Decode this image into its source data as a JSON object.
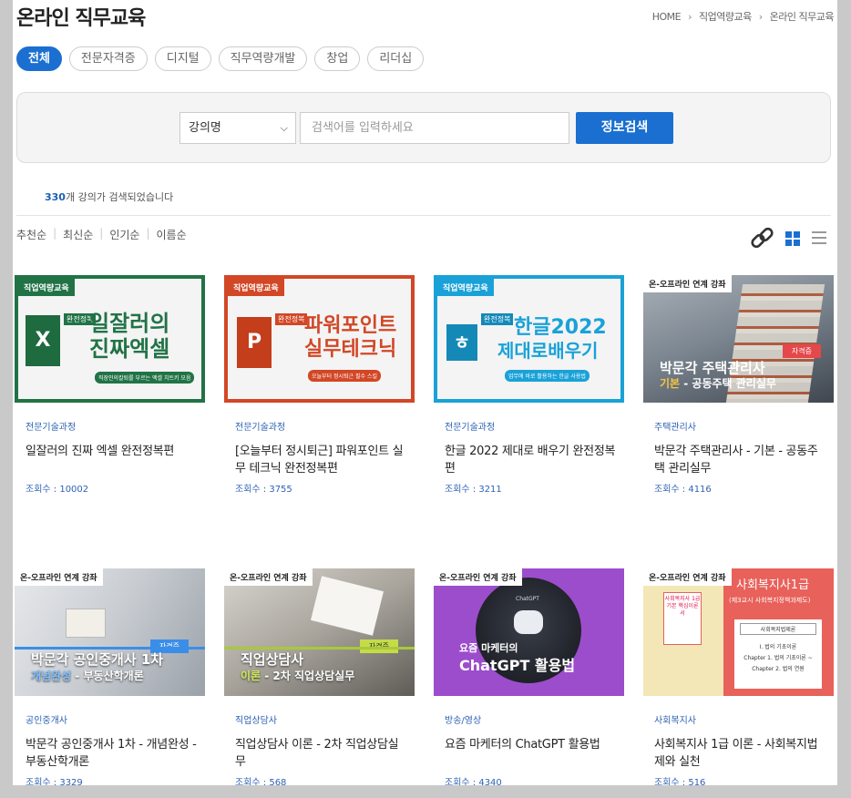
{
  "header": {
    "title": "온라인 직무교육",
    "breadcrumb": [
      "HOME",
      "직업역량교육",
      "온라인 직무교육"
    ]
  },
  "tabs": [
    {
      "label": "전체",
      "active": true
    },
    {
      "label": "전문자격증",
      "active": false
    },
    {
      "label": "디지털",
      "active": false
    },
    {
      "label": "직무역량개발",
      "active": false
    },
    {
      "label": "창업",
      "active": false
    },
    {
      "label": "리더십",
      "active": false
    }
  ],
  "search": {
    "select_value": "강의명",
    "placeholder": "검색어를 입력하세요",
    "button": "정보검색"
  },
  "result": {
    "count": "330",
    "suffix": "개 강의가 검색되었습니다"
  },
  "sort": [
    "추천순",
    "최신순",
    "인기순",
    "이름순"
  ],
  "courses": [
    {
      "category": "전문기술과정",
      "title": "일잘러의 진짜 엑셀 완전정복편",
      "views": "조회수 : 10002",
      "thumb": {
        "tag": "직업역량교육",
        "badge": "완전정복",
        "line1": "일잘러의",
        "line2": "진짜엑셀",
        "sub": "직장인의칼퇴를 부르는 엑셀 치트키 모음",
        "color": "#217346"
      }
    },
    {
      "category": "전문기술과정",
      "title": "[오늘부터 정시퇴근] 파워포인트 실무 테크닉 완전정복편",
      "views": "조회수 : 3755",
      "thumb": {
        "tag": "직업역량교육",
        "badge": "완전정복",
        "line1": "파워포인트",
        "line2": "실무테크닉",
        "sub": "오늘부터 정시퇴근 필수 스킬",
        "color": "#d24726"
      }
    },
    {
      "category": "전문기술과정",
      "title": "한글 2022 제대로 배우기 완전정복편",
      "views": "조회수 : 3211",
      "thumb": {
        "tag": "직업역량교육",
        "badge": "완전정복",
        "line1": "한글2022",
        "line2": "제대로배우기",
        "sub": "업무에 바로 활용하는 한글 사용법",
        "color": "#1aa2d8"
      }
    },
    {
      "category": "주택관리사",
      "title": "박문각 주택관리사 - 기본 - 공동주택 관리실무",
      "views": "조회수 : 4116",
      "thumb": {
        "tag": "온-오프라인 연계 강좌",
        "badge": "자격증",
        "line1": "박문각 주택관리사",
        "line2a": "기본",
        "line2b": " - 공동주택 관리실무",
        "color": "#e5474b"
      }
    },
    {
      "category": "공인중개사",
      "title": "박문각 공인중개사 1차 - 개념완성 - 부동산학개론",
      "views": "조회수 : 3329",
      "thumb": {
        "tag": "온-오프라인 연계 강좌",
        "badge": "자격증",
        "line1": "박문각 공인중개사 1차",
        "line2a": "개념완성",
        "line2b": " - 부동산학개론",
        "color": "#3b8ee8"
      }
    },
    {
      "category": "직업상담사",
      "title": "직업상담사 이론 - 2차 직업상담실무",
      "views": "조회수 : 568",
      "thumb": {
        "tag": "온-오프라인 연계 강좌",
        "badge": "자격증",
        "line1": "직업상담사",
        "line2a": "이론",
        "line2b": " - 2차 직업상담실무",
        "color": "#a8c93a"
      }
    },
    {
      "category": "방송/영상",
      "title": "요즘 마케터의 ChatGPT 활용법",
      "views": "조회수 : 4340",
      "thumb": {
        "tag": "온-오프라인 연계 강좌",
        "badge": "ChatGPT",
        "line1": "요즘 마케터의",
        "line2": "ChatGPT 활용법",
        "color": "#9c4dcc"
      }
    },
    {
      "category": "사회복지사",
      "title": "사회복지사 1급 이론 - 사회복지법제와 실천",
      "views": "조회수 : 516",
      "thumb": {
        "tag": "온-오프라인 연계 강좌",
        "badge": "사회복지사 1급 기본 핵심이론서",
        "line1": "사회복지사1급",
        "line2": "(제3교시 사회복지정책과제도)",
        "sub": "사회복지법제론",
        "note1": "I. 법의 기초이론",
        "note2": "Chapter 1. 법의 기초이론 ~",
        "note3": "Chapter 2. 법의 연원",
        "color": "#e8615a"
      }
    }
  ]
}
